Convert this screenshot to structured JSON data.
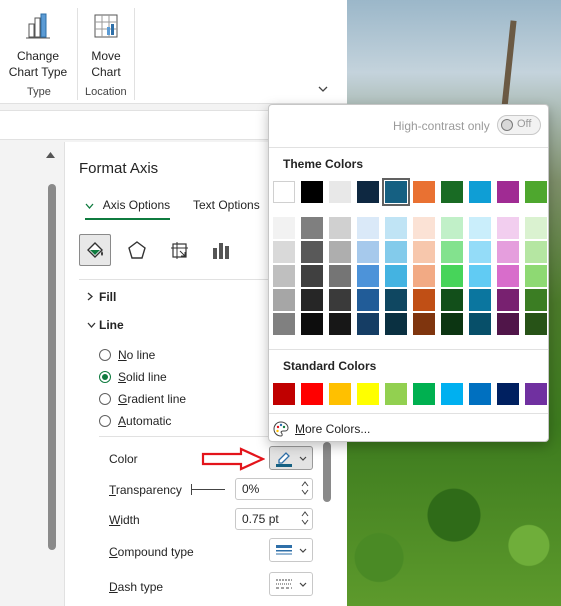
{
  "ribbon": {
    "change_chart_type": {
      "line1": "Change",
      "line2": "Chart Type"
    },
    "move_chart": {
      "line1": "Move",
      "line2": "Chart"
    },
    "group_type": "Type",
    "group_location": "Location",
    "collapse_icon": "chevron-down-icon"
  },
  "pane": {
    "title": "Format Axis",
    "tabs": {
      "axis_options": "Axis Options",
      "text_options": "Text Options"
    },
    "icons": [
      "fill-line-icon",
      "effects-pentagon-icon",
      "size-properties-icon",
      "axis-options-bars-icon"
    ],
    "sections": {
      "fill": "Fill",
      "line": "Line"
    },
    "line_options": {
      "no_line": {
        "u": "N",
        "rest": "o line"
      },
      "solid_line": {
        "u": "S",
        "rest": "olid line"
      },
      "gradient_line": {
        "u": "G",
        "rest": "radient line"
      },
      "automatic": {
        "u": "A",
        "rest": "utomatic"
      },
      "selected": "solid_line"
    },
    "fields": {
      "color": {
        "label": "Color"
      },
      "transparency": {
        "u": "T",
        "rest": "ransparency",
        "value": "0%"
      },
      "width": {
        "u": "W",
        "rest": "idth",
        "value": "0.75 pt"
      },
      "compound_type": {
        "u": "C",
        "rest": "ompound type"
      },
      "dash_type": {
        "u": "D",
        "rest": "ash type"
      }
    }
  },
  "picker": {
    "high_contrast_label": "High-contrast only",
    "toggle_label": "Off",
    "theme_heading": "Theme Colors",
    "standard_heading": "Standard Colors",
    "more_colors": {
      "u": "M",
      "rest": "ore Colors..."
    },
    "theme_colors": [
      "#ffffff",
      "#000000",
      "#e8e8e8",
      "#0e2841",
      "#156082",
      "#e97132",
      "#196b24",
      "#0f9ed5",
      "#a02b93",
      "#4ea72e"
    ],
    "theme_shades": [
      [
        "#f2f2f2",
        "#d9d9d9",
        "#bfbfbf",
        "#a6a6a6",
        "#808080"
      ],
      [
        "#7f7f7f",
        "#595959",
        "#404040",
        "#262626",
        "#0d0d0d"
      ],
      [
        "#d0d0d0",
        "#aeaeae",
        "#757575",
        "#3a3a3a",
        "#171717"
      ],
      [
        "#dae9f8",
        "#a6c9ec",
        "#4d93d9",
        "#215c98",
        "#153d64"
      ],
      [
        "#c0e4f5",
        "#83cbeb",
        "#44b3e1",
        "#0f4761",
        "#0a3041"
      ],
      [
        "#fbe2d5",
        "#f7c7ac",
        "#f2aa84",
        "#c04f15",
        "#7f350e"
      ],
      [
        "#c1f0c8",
        "#83e28e",
        "#47d45a",
        "#124f1a",
        "#0c3512"
      ],
      [
        "#caeefb",
        "#94dcf8",
        "#61cbf3",
        "#0b769f",
        "#074f69"
      ],
      [
        "#f2ceef",
        "#e59edd",
        "#d86dcb",
        "#782170",
        "#501549"
      ],
      [
        "#daf2d0",
        "#b5e6a2",
        "#8ed973",
        "#3b7d23",
        "#275317"
      ]
    ],
    "selected_theme_index": 4,
    "standard_colors": [
      "#c00000",
      "#ff0000",
      "#ffc000",
      "#ffff00",
      "#92d050",
      "#00b050",
      "#00b0f0",
      "#0070c0",
      "#002060",
      "#7030a0"
    ]
  }
}
